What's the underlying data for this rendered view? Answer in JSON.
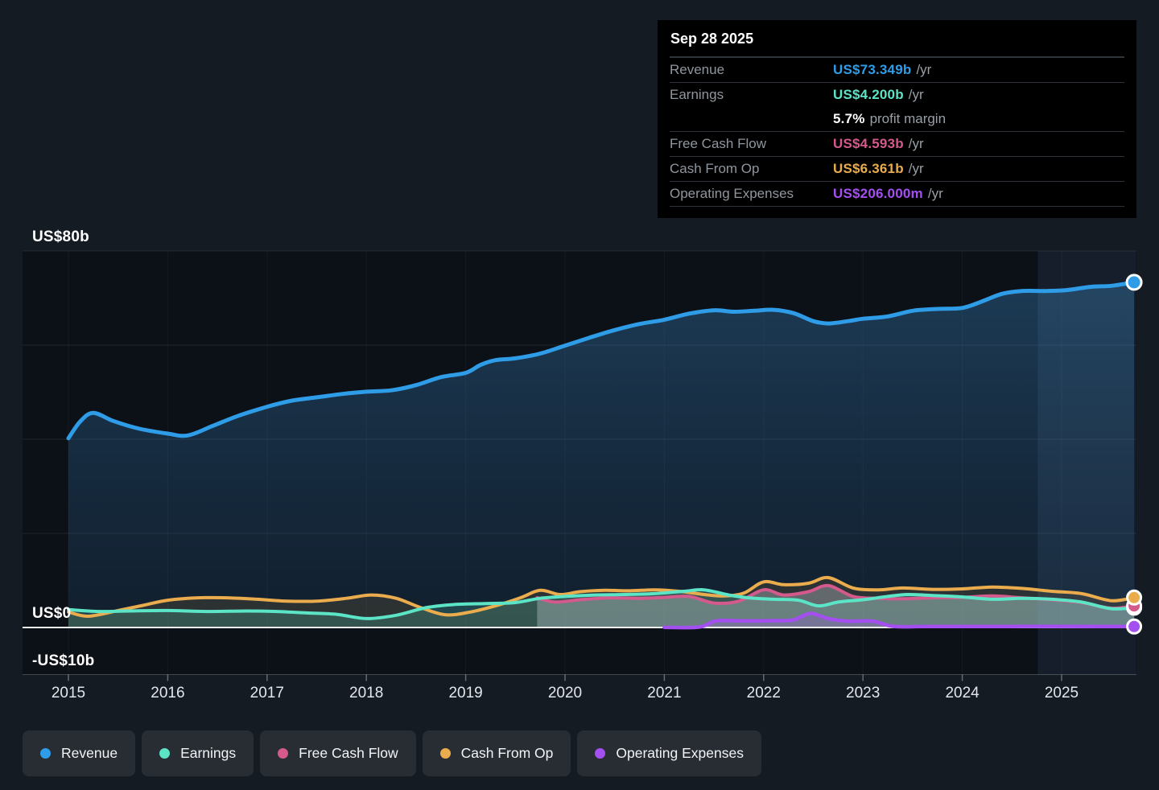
{
  "tooltip": {
    "date": "Sep 28 2025",
    "rows": [
      {
        "label": "Revenue",
        "value": "US$73.349b",
        "unit": "/yr",
        "color_key": "revenue"
      },
      {
        "label": "Earnings",
        "value": "US$4.200b",
        "unit": "/yr",
        "color_key": "earnings"
      },
      {
        "label": "Free Cash Flow",
        "value": "US$4.593b",
        "unit": "/yr",
        "color_key": "free_cash_flow"
      },
      {
        "label": "Cash From Op",
        "value": "US$6.361b",
        "unit": "/yr",
        "color_key": "cash_from_op"
      },
      {
        "label": "Operating Expenses",
        "value": "US$206.000m",
        "unit": "/yr",
        "color_key": "operating_expenses"
      }
    ],
    "profit_margin": {
      "value": "5.7%",
      "label": "profit margin"
    }
  },
  "palette": {
    "revenue": "#2F9CE8",
    "earnings": "#5CE4C6",
    "free_cash_flow": "#D4598C",
    "cash_from_op": "#EBAC4E",
    "operating_expenses": "#A44FF0"
  },
  "axis": {
    "y_labels": [
      {
        "label": "US$80b",
        "value": 80
      },
      {
        "label": "US$0",
        "value": 0
      },
      {
        "label": "-US$10b",
        "value": -10
      }
    ],
    "x_ticks": [
      {
        "label": "2015",
        "year": 2015
      },
      {
        "label": "2016",
        "year": 2016
      },
      {
        "label": "2017",
        "year": 2017
      },
      {
        "label": "2018",
        "year": 2018
      },
      {
        "label": "2019",
        "year": 2019
      },
      {
        "label": "2020",
        "year": 2020
      },
      {
        "label": "2021",
        "year": 2021
      },
      {
        "label": "2022",
        "year": 2022
      },
      {
        "label": "2023",
        "year": 2023
      },
      {
        "label": "2024",
        "year": 2024
      },
      {
        "label": "2025",
        "year": 2025
      }
    ]
  },
  "legend": {
    "items": [
      {
        "label": "Revenue",
        "key": "revenue"
      },
      {
        "label": "Earnings",
        "key": "earnings"
      },
      {
        "label": "Free Cash Flow",
        "key": "free_cash_flow"
      },
      {
        "label": "Cash From Op",
        "key": "cash_from_op"
      },
      {
        "label": "Operating Expenses",
        "key": "operating_expenses"
      }
    ]
  },
  "chart_data": {
    "type": "area",
    "title": "",
    "xlabel": "",
    "ylabel": "US$ billions",
    "x_range": [
      2015,
      2025.75
    ],
    "ylim_display": [
      -10,
      80
    ],
    "gridline_values": [
      80,
      60,
      40,
      20
    ],
    "zero_line_value": 0,
    "bottom_line_value": -10,
    "highlight_band": {
      "start": 2024.76,
      "end": 2025.75,
      "meaning": "trailing twelve months"
    },
    "as_of_date": "Sep 28 2025",
    "series": [
      {
        "name": "Revenue",
        "key": "revenue",
        "unit": "US$b",
        "end_value": 73.349,
        "points": [
          [
            2015.0,
            40.2
          ],
          [
            2015.12,
            43.8
          ],
          [
            2015.25,
            45.6
          ],
          [
            2015.45,
            43.9
          ],
          [
            2015.7,
            42.3
          ],
          [
            2016.0,
            41.2
          ],
          [
            2016.2,
            40.8
          ],
          [
            2016.45,
            42.8
          ],
          [
            2016.7,
            44.9
          ],
          [
            2017.0,
            46.9
          ],
          [
            2017.25,
            48.2
          ],
          [
            2017.5,
            48.9
          ],
          [
            2017.75,
            49.6
          ],
          [
            2018.0,
            50.1
          ],
          [
            2018.25,
            50.4
          ],
          [
            2018.5,
            51.5
          ],
          [
            2018.75,
            53.2
          ],
          [
            2019.0,
            54.1
          ],
          [
            2019.15,
            55.8
          ],
          [
            2019.3,
            56.8
          ],
          [
            2019.5,
            57.2
          ],
          [
            2019.75,
            58.2
          ],
          [
            2020.0,
            59.9
          ],
          [
            2020.25,
            61.6
          ],
          [
            2020.5,
            63.2
          ],
          [
            2020.75,
            64.5
          ],
          [
            2021.0,
            65.4
          ],
          [
            2021.25,
            66.7
          ],
          [
            2021.5,
            67.4
          ],
          [
            2021.7,
            67.1
          ],
          [
            2021.9,
            67.3
          ],
          [
            2022.1,
            67.5
          ],
          [
            2022.3,
            66.8
          ],
          [
            2022.5,
            65.1
          ],
          [
            2022.65,
            64.6
          ],
          [
            2022.85,
            65.1
          ],
          [
            2023.0,
            65.6
          ],
          [
            2023.25,
            66.1
          ],
          [
            2023.5,
            67.3
          ],
          [
            2023.75,
            67.7
          ],
          [
            2024.0,
            67.9
          ],
          [
            2024.2,
            69.3
          ],
          [
            2024.4,
            70.9
          ],
          [
            2024.6,
            71.5
          ],
          [
            2024.85,
            71.5
          ],
          [
            2025.05,
            71.7
          ],
          [
            2025.3,
            72.4
          ],
          [
            2025.5,
            72.6
          ],
          [
            2025.73,
            73.349
          ]
        ]
      },
      {
        "name": "Earnings",
        "key": "earnings",
        "unit": "US$b",
        "end_value": 4.2,
        "points": [
          [
            2015.0,
            3.8
          ],
          [
            2015.3,
            3.4
          ],
          [
            2015.6,
            3.5
          ],
          [
            2016.0,
            3.6
          ],
          [
            2016.4,
            3.4
          ],
          [
            2016.8,
            3.5
          ],
          [
            2017.1,
            3.4
          ],
          [
            2017.4,
            3.1
          ],
          [
            2017.7,
            2.8
          ],
          [
            2018.0,
            1.9
          ],
          [
            2018.3,
            2.6
          ],
          [
            2018.6,
            4.2
          ],
          [
            2018.9,
            4.9
          ],
          [
            2019.2,
            5.1
          ],
          [
            2019.5,
            5.3
          ],
          [
            2019.75,
            6.2
          ],
          [
            2020.0,
            6.6
          ],
          [
            2020.3,
            6.9
          ],
          [
            2020.6,
            7.0
          ],
          [
            2020.9,
            7.2
          ],
          [
            2021.2,
            7.7
          ],
          [
            2021.4,
            8.0
          ],
          [
            2021.65,
            6.9
          ],
          [
            2021.85,
            6.3
          ],
          [
            2022.1,
            6.0
          ],
          [
            2022.35,
            5.8
          ],
          [
            2022.55,
            4.6
          ],
          [
            2022.75,
            5.4
          ],
          [
            2023.0,
            5.9
          ],
          [
            2023.25,
            6.6
          ],
          [
            2023.45,
            7.0
          ],
          [
            2023.7,
            6.8
          ],
          [
            2024.0,
            6.5
          ],
          [
            2024.3,
            6.0
          ],
          [
            2024.6,
            6.2
          ],
          [
            2024.9,
            6.0
          ],
          [
            2025.2,
            5.4
          ],
          [
            2025.5,
            4.0
          ],
          [
            2025.73,
            4.2
          ]
        ]
      },
      {
        "name": "Free Cash Flow",
        "key": "free_cash_flow",
        "unit": "US$b",
        "end_value": 4.593,
        "points": [
          [
            2019.72,
            6.3
          ],
          [
            2019.9,
            5.4
          ],
          [
            2020.15,
            5.9
          ],
          [
            2020.45,
            6.3
          ],
          [
            2020.75,
            6.2
          ],
          [
            2021.0,
            6.4
          ],
          [
            2021.25,
            6.6
          ],
          [
            2021.5,
            5.2
          ],
          [
            2021.75,
            5.6
          ],
          [
            2022.0,
            8.0
          ],
          [
            2022.2,
            6.9
          ],
          [
            2022.45,
            7.6
          ],
          [
            2022.65,
            8.9
          ],
          [
            2022.9,
            6.6
          ],
          [
            2023.15,
            6.2
          ],
          [
            2023.4,
            6.1
          ],
          [
            2023.7,
            6.3
          ],
          [
            2024.0,
            6.4
          ],
          [
            2024.3,
            6.7
          ],
          [
            2024.6,
            6.3
          ],
          [
            2024.9,
            5.9
          ],
          [
            2025.2,
            5.3
          ],
          [
            2025.5,
            4.1
          ],
          [
            2025.73,
            4.593
          ]
        ]
      },
      {
        "name": "Cash From Op",
        "key": "cash_from_op",
        "unit": "US$b",
        "end_value": 6.361,
        "points": [
          [
            2015.0,
            3.3
          ],
          [
            2015.2,
            2.4
          ],
          [
            2015.5,
            3.6
          ],
          [
            2015.75,
            4.7
          ],
          [
            2016.0,
            5.8
          ],
          [
            2016.3,
            6.3
          ],
          [
            2016.6,
            6.3
          ],
          [
            2016.9,
            6.0
          ],
          [
            2017.2,
            5.6
          ],
          [
            2017.5,
            5.6
          ],
          [
            2017.8,
            6.2
          ],
          [
            2018.05,
            6.9
          ],
          [
            2018.3,
            6.2
          ],
          [
            2018.55,
            4.2
          ],
          [
            2018.8,
            2.7
          ],
          [
            2019.05,
            3.3
          ],
          [
            2019.3,
            4.6
          ],
          [
            2019.55,
            6.3
          ],
          [
            2019.75,
            7.9
          ],
          [
            2019.95,
            7.0
          ],
          [
            2020.15,
            7.6
          ],
          [
            2020.4,
            7.9
          ],
          [
            2020.65,
            7.8
          ],
          [
            2020.9,
            8.0
          ],
          [
            2021.15,
            7.7
          ],
          [
            2021.4,
            7.0
          ],
          [
            2021.6,
            6.7
          ],
          [
            2021.8,
            7.3
          ],
          [
            2022.0,
            9.7
          ],
          [
            2022.2,
            9.1
          ],
          [
            2022.45,
            9.4
          ],
          [
            2022.65,
            10.6
          ],
          [
            2022.9,
            8.4
          ],
          [
            2023.15,
            8.0
          ],
          [
            2023.4,
            8.4
          ],
          [
            2023.7,
            8.1
          ],
          [
            2024.0,
            8.2
          ],
          [
            2024.3,
            8.6
          ],
          [
            2024.6,
            8.3
          ],
          [
            2024.9,
            7.7
          ],
          [
            2025.2,
            7.2
          ],
          [
            2025.5,
            5.7
          ],
          [
            2025.73,
            6.361
          ]
        ]
      },
      {
        "name": "Operating Expenses",
        "key": "operating_expenses",
        "unit": "US$b",
        "end_value": 0.206,
        "points": [
          [
            2021.0,
            0.05
          ],
          [
            2021.35,
            0.08
          ],
          [
            2021.52,
            1.4
          ],
          [
            2021.8,
            1.4
          ],
          [
            2022.1,
            1.45
          ],
          [
            2022.3,
            1.6
          ],
          [
            2022.47,
            3.0
          ],
          [
            2022.65,
            1.9
          ],
          [
            2022.85,
            1.35
          ],
          [
            2023.1,
            1.35
          ],
          [
            2023.3,
            0.25
          ],
          [
            2023.6,
            0.2
          ],
          [
            2024.0,
            0.2
          ],
          [
            2024.5,
            0.22
          ],
          [
            2025.0,
            0.24
          ],
          [
            2025.4,
            0.22
          ],
          [
            2025.73,
            0.206
          ]
        ]
      }
    ]
  }
}
